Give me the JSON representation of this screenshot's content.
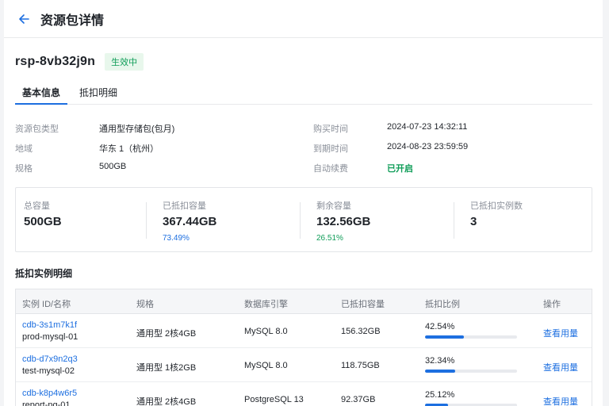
{
  "header": {
    "title": "资源包详情"
  },
  "package": {
    "id": "rsp-8vb32j9n",
    "status": "生效中"
  },
  "tabs": [
    {
      "label": "基本信息"
    },
    {
      "label": "抵扣明细"
    }
  ],
  "info": {
    "type_label": "资源包类型",
    "type_value": "通用型存储包(包月)",
    "region_label": "地域",
    "region_value": "华东 1（杭州）",
    "spec_label": "规格",
    "spec_value": "500GB",
    "purchase_label": "购买时间",
    "purchase_value": "2024-07-23 14:32:11",
    "expire_label": "到期时间",
    "expire_value": "2024-08-23 23:59:59",
    "renew_label": "自动续费",
    "renew_value": "已开启"
  },
  "stats": {
    "total_label": "总容量",
    "total_value": "500GB",
    "used_label": "已抵扣容量",
    "used_value": "367.44GB",
    "used_pct": "73.49%",
    "remain_label": "剩余容量",
    "remain_value": "132.56GB",
    "remain_pct": "26.51%",
    "count_label": "已抵扣实例数",
    "count_value": "3"
  },
  "colors": {
    "accent": "#1d6fe0",
    "success": "#0f9d58"
  },
  "section": {
    "title": "抵扣实例明细"
  },
  "table": {
    "columns": [
      "实例 ID/名称",
      "规格",
      "数据库引擎",
      "已抵扣容量",
      "抵扣比例",
      "操作"
    ],
    "rows": [
      {
        "id": "cdb-3s1m7k1f",
        "name": "prod-mysql-01",
        "spec": "通用型 2核4GB",
        "engine": "MySQL 8.0",
        "used": "156.32GB",
        "ratio": "42.54%",
        "ratio_value": 0.4254,
        "action": "查看用量"
      },
      {
        "id": "cdb-d7x9n2q3",
        "name": "test-mysql-02",
        "spec": "通用型 1核2GB",
        "engine": "MySQL 8.0",
        "used": "118.75GB",
        "ratio": "32.34%",
        "ratio_value": 0.3234,
        "action": "查看用量"
      },
      {
        "id": "cdb-k8p4w6r5",
        "name": "report-pg-01",
        "spec": "通用型 2核4GB",
        "engine": "PostgreSQL 13",
        "used": "92.37GB",
        "ratio": "25.12%",
        "ratio_value": 0.2512,
        "action": "查看用量"
      }
    ]
  }
}
